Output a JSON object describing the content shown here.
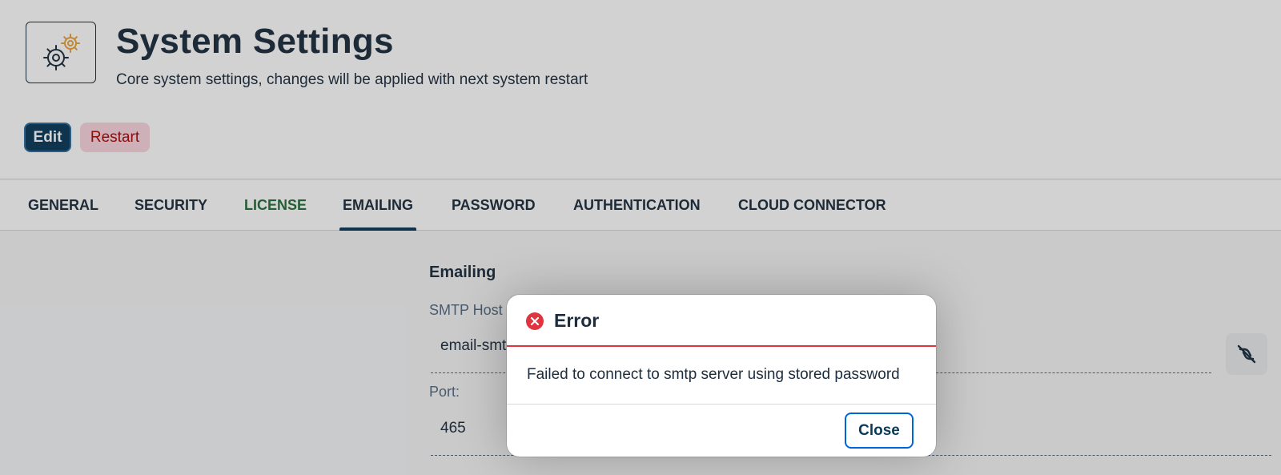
{
  "header": {
    "app_icon": "gears-icon",
    "title": "System Settings",
    "subtitle": "Core system settings, changes will be applied with next system restart",
    "edit_label": "Edit",
    "restart_label": "Restart"
  },
  "tabs": [
    {
      "label": "GENERAL"
    },
    {
      "label": "SECURITY"
    },
    {
      "label": "LICENSE"
    },
    {
      "label": "EMAILING",
      "active": true
    },
    {
      "label": "PASSWORD"
    },
    {
      "label": "AUTHENTICATION"
    },
    {
      "label": "CLOUD CONNECTOR"
    }
  ],
  "emailing": {
    "section_title": "Emailing",
    "smtp_host_label": "SMTP Host",
    "smtp_host_value": "email-smt",
    "port_label": "Port:",
    "port_value": "465",
    "side_button_icon": "disconnect-icon"
  },
  "dialog": {
    "title": "Error",
    "message": "Failed to connect to smtp server using stored password",
    "close_label": "Close",
    "icon": "error-icon"
  },
  "colors": {
    "primary": "#0a3a5a",
    "error": "#e0343f",
    "license_tab": "#256f3a",
    "restart_bg": "#fbd6df",
    "restart_text": "#aa0808"
  }
}
